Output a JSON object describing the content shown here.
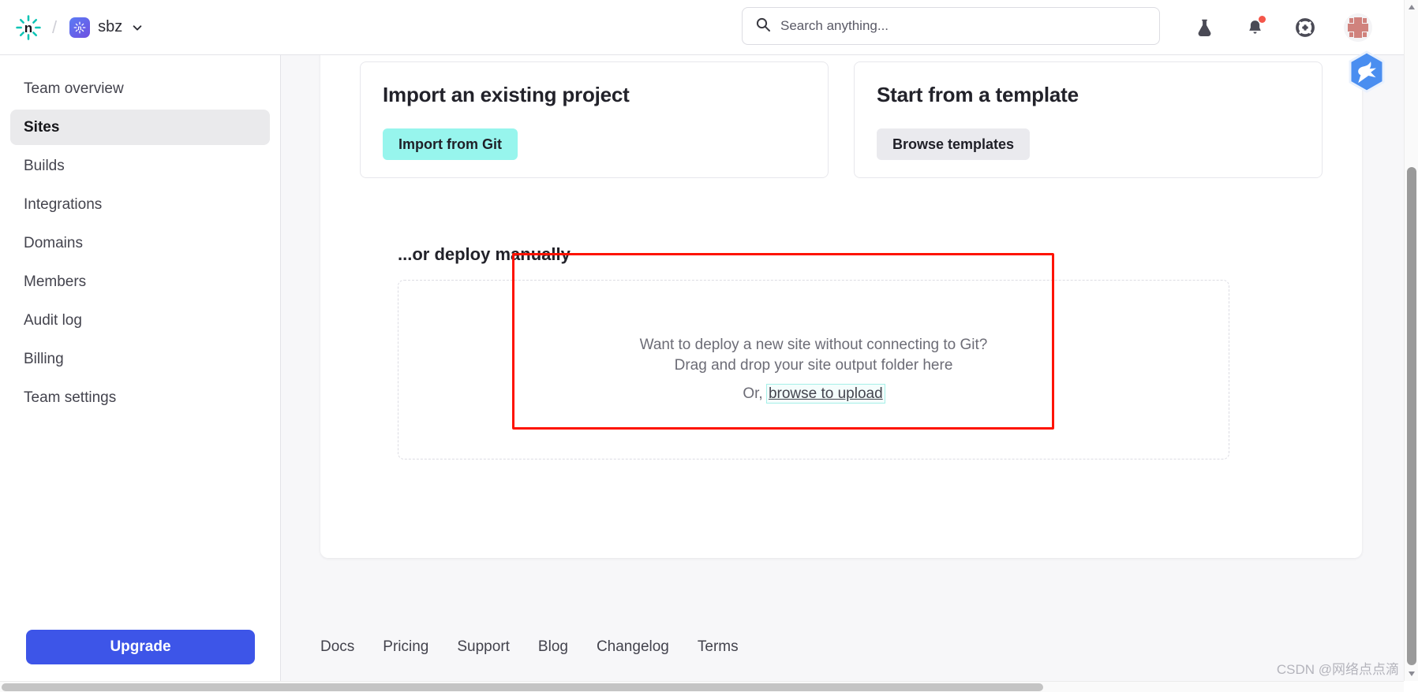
{
  "header": {
    "logo_icon": "netlify-logo-icon",
    "separator": "/",
    "team_name": "sbz",
    "team_avatar_icon": "netlify-team-avatar-icon",
    "chevron_icon": "chevron-down-icon",
    "search": {
      "placeholder": "Search anything...",
      "value": "",
      "icon": "search-icon"
    },
    "icons": [
      {
        "name": "labs-flask-icon",
        "label": "Labs"
      },
      {
        "name": "notifications-bell-icon",
        "label": "Notifications",
        "has_badge": true
      },
      {
        "name": "help-lifebuoy-icon",
        "label": "Help"
      }
    ],
    "avatar": {
      "name": "user-avatar",
      "label": "User account"
    }
  },
  "extension_badge": {
    "name": "bird-extension-icon",
    "color": "#4a8ef0"
  },
  "sidebar": {
    "items": [
      {
        "label": "Team overview",
        "active": false
      },
      {
        "label": "Sites",
        "active": true
      },
      {
        "label": "Builds",
        "active": false
      },
      {
        "label": "Integrations",
        "active": false
      },
      {
        "label": "Domains",
        "active": false
      },
      {
        "label": "Members",
        "active": false
      },
      {
        "label": "Audit log",
        "active": false
      },
      {
        "label": "Billing",
        "active": false
      },
      {
        "label": "Team settings",
        "active": false
      }
    ],
    "upgrade_label": "Upgrade",
    "upgrade_color": "#3d55e8"
  },
  "main": {
    "cards": [
      {
        "title": "Import an existing project",
        "button_label": "Import from Git",
        "button_color": "#97f5ed"
      },
      {
        "title": "Start from a template",
        "button_label": "Browse templates",
        "button_color": "#eaeaee"
      }
    ],
    "manual_section_title": "...or deploy manually",
    "dropzone": {
      "line1": "Want to deploy a new site without connecting to Git?",
      "line2": "Drag and drop your site output folder here",
      "line3_prefix": "Or,",
      "link_label": "browse to upload"
    }
  },
  "annotation": {
    "color": "#fe1300",
    "shape": "rectangle"
  },
  "footer": {
    "links": [
      {
        "label": "Docs"
      },
      {
        "label": "Pricing"
      },
      {
        "label": "Support"
      },
      {
        "label": "Blog"
      },
      {
        "label": "Changelog"
      },
      {
        "label": "Terms"
      }
    ]
  },
  "watermark": {
    "text": "CSDN @网络点点滴"
  }
}
